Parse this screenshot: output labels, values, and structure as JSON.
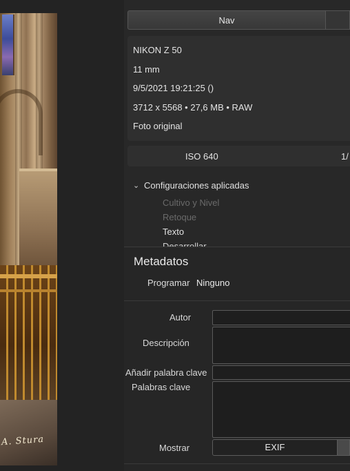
{
  "photo": {
    "signature": "A. Stura"
  },
  "nav": {
    "tab_label": "Nav"
  },
  "camera_info": {
    "camera": "NIKON Z 50",
    "focal_length": "11 mm",
    "datetime": "9/5/2021 19:21:25 ()",
    "dimensions": "3712 x 5568 • 27,6 MB • RAW",
    "version": "Foto original"
  },
  "exposure": {
    "iso": "ISO 640",
    "shutter": "1/"
  },
  "applied_settings": {
    "header": "Configuraciones aplicadas",
    "items": [
      {
        "label": "Cultivo y Nivel",
        "state": "dim"
      },
      {
        "label": "Retoque",
        "state": "dim"
      },
      {
        "label": "Texto",
        "state": "lit"
      },
      {
        "label": "Desarrollar",
        "state": "cut"
      }
    ]
  },
  "metadata": {
    "title": "Metadatos",
    "programar_label": "Programar",
    "programar_value": "Ninguno",
    "fields": {
      "autor": "Autor",
      "descripcion": "Descripción",
      "anadir": "Añadir palabra clave",
      "palabras": "Palabras clave",
      "mostrar": "Mostrar"
    },
    "show_button": "EXIF"
  }
}
